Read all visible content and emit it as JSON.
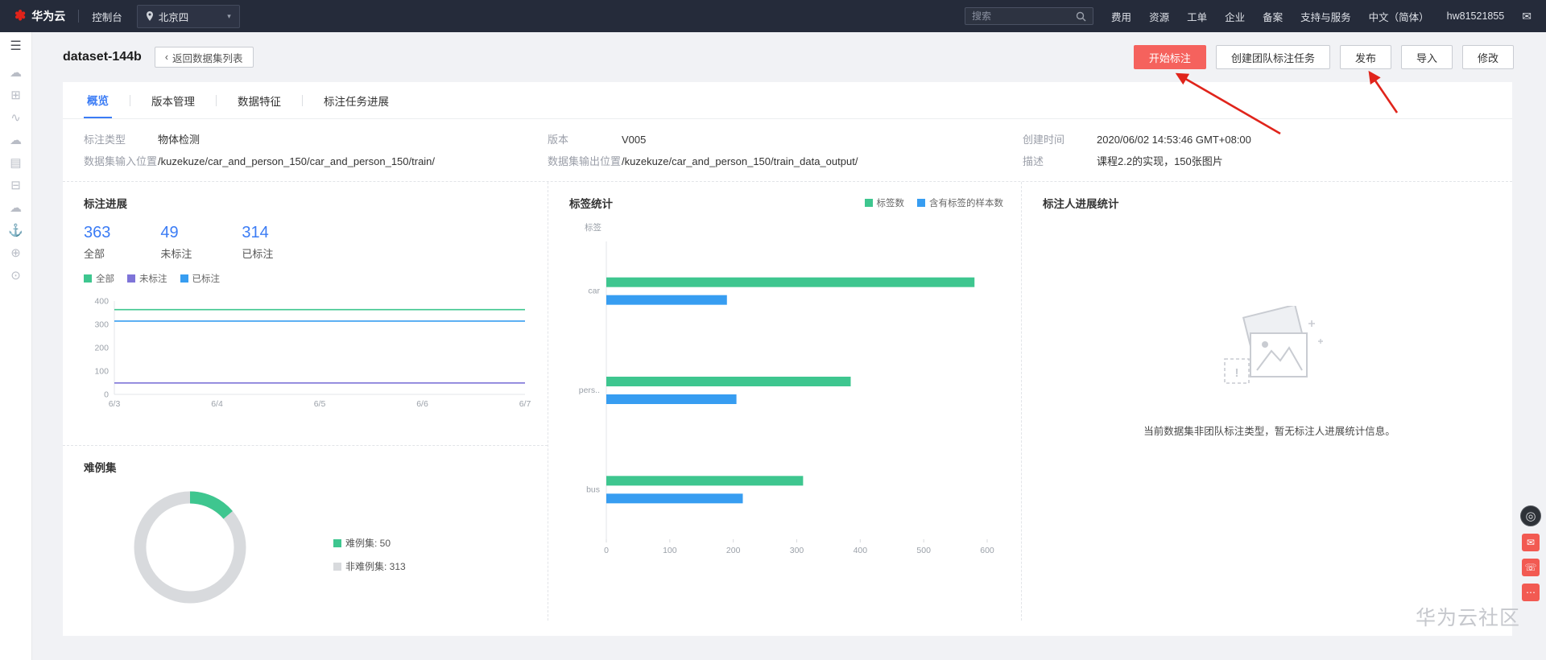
{
  "topbar": {
    "brand": "华为云",
    "console": "控制台",
    "region": "北京四",
    "search_placeholder": "搜索",
    "menu": [
      "费用",
      "资源",
      "工单",
      "企业",
      "备案",
      "支持与服务"
    ],
    "language": "中文（简体）",
    "account": "hw81521855"
  },
  "icons": {
    "hamburger": "☰",
    "back_chevron": "‹",
    "dropdown_caret": "▾",
    "mail": "✉"
  },
  "sidebar": {
    "icons": [
      {
        "name": "menu",
        "glyph": "☰"
      },
      {
        "name": "cloud-server",
        "glyph": "☁"
      },
      {
        "name": "user-group",
        "glyph": "⊞"
      },
      {
        "name": "monitor",
        "glyph": "∿"
      },
      {
        "name": "cloud-storage",
        "glyph": "☁"
      },
      {
        "name": "document",
        "glyph": "▤"
      },
      {
        "name": "database",
        "glyph": "⊟"
      },
      {
        "name": "cloud-service",
        "glyph": "☁"
      },
      {
        "name": "deploy",
        "glyph": "⚓"
      },
      {
        "name": "network",
        "glyph": "⊕"
      },
      {
        "name": "support",
        "glyph": "⊙"
      }
    ]
  },
  "header": {
    "title": "dataset-144b",
    "back_label": "返回数据集列表",
    "buttons": [
      {
        "label": "开始标注",
        "style": "primary"
      },
      {
        "label": "创建团队标注任务"
      },
      {
        "label": "发布"
      },
      {
        "label": "导入"
      },
      {
        "label": "修改"
      }
    ]
  },
  "tabs": {
    "items": [
      {
        "label": "概览",
        "active": true
      },
      {
        "label": "版本管理",
        "active": false
      },
      {
        "label": "数据特征",
        "active": false
      },
      {
        "label": "标注任务进展",
        "active": false
      }
    ]
  },
  "info": {
    "columns": [
      {
        "rows": [
          {
            "label": "标注类型",
            "value": "物体检测"
          },
          {
            "label": "数据集输入位置",
            "value": "/kuzekuze/car_and_person_150/car_and_person_150/train/"
          }
        ]
      },
      {
        "rows": [
          {
            "label": "版本",
            "value": "V005"
          },
          {
            "label": "数据集输出位置",
            "value": "/kuzekuze/car_and_person_150/train_data_output/"
          }
        ]
      },
      {
        "rows": [
          {
            "label": "创建时间",
            "value": "2020/06/02 14:53:46 GMT+08:00"
          },
          {
            "label": "描述",
            "value": "课程2.2的实现，150张图片"
          }
        ]
      }
    ]
  },
  "progress": {
    "title": "标注进展",
    "stats": [
      {
        "value": "363",
        "label": "全部"
      },
      {
        "value": "49",
        "label": "未标注"
      },
      {
        "value": "314",
        "label": "已标注"
      }
    ]
  },
  "hard": {
    "title": "难例集",
    "legend": [
      {
        "text": "难例集: 50"
      },
      {
        "text": "非难例集: 313"
      }
    ]
  },
  "labels_panel": {
    "title": "标签统计"
  },
  "annotator": {
    "title": "标注人进展统计",
    "message": "当前数据集非团队标注类型，暂无标注人进展统计信息。"
  },
  "watermark": "华为云社区",
  "widgets": {
    "assistant_glyph": "◎",
    "icons": [
      {
        "name": "mail",
        "glyph": "✉"
      },
      {
        "name": "phone",
        "glyph": "☏"
      },
      {
        "name": "chat",
        "glyph": "⋯"
      }
    ]
  },
  "colors": {
    "primary_red": "#f5625d",
    "accent_blue": "#3b7cf5",
    "chart_green": "#3ec68f",
    "chart_blue": "#379df1",
    "chart_purple": "#7e74d8",
    "chart_gray": "#d8dadd"
  },
  "chart_data": [
    {
      "id": "annotation_progress",
      "type": "line",
      "title": "标注进展",
      "x": [
        "6/3",
        "6/4",
        "6/5",
        "6/6",
        "6/7"
      ],
      "series": [
        {
          "name": "全部",
          "color": "#3ec68f",
          "values": [
            363,
            363,
            363,
            363,
            363
          ]
        },
        {
          "name": "未标注",
          "color": "#7e74d8",
          "values": [
            49,
            49,
            49,
            49,
            49
          ]
        },
        {
          "name": "已标注",
          "color": "#379df1",
          "values": [
            314,
            314,
            314,
            314,
            314
          ]
        }
      ],
      "ylim": [
        0,
        400
      ],
      "yticks": [
        0,
        100,
        200,
        300,
        400
      ],
      "legend_position": "top",
      "grid": false
    },
    {
      "id": "hard_example_set",
      "type": "pie",
      "title": "难例集",
      "donut": true,
      "slices": [
        {
          "label": "难例集",
          "value": 50,
          "color": "#3ec68f"
        },
        {
          "label": "非难例集",
          "value": 313,
          "color": "#d8dadd"
        }
      ]
    },
    {
      "id": "label_statistics",
      "type": "bar",
      "orientation": "horizontal",
      "title": "标签统计",
      "categories": [
        "car",
        "pers..",
        "bus"
      ],
      "series": [
        {
          "name": "标签数",
          "color": "#3ec68f",
          "values": [
            580,
            385,
            310
          ]
        },
        {
          "name": "含有标签的样本数",
          "color": "#379df1",
          "values": [
            190,
            205,
            215
          ]
        }
      ],
      "xlim": [
        0,
        600
      ],
      "xticks": [
        0,
        100,
        200,
        300,
        400,
        500,
        600
      ],
      "ylabel": "标签",
      "legend_position": "top-right"
    }
  ]
}
